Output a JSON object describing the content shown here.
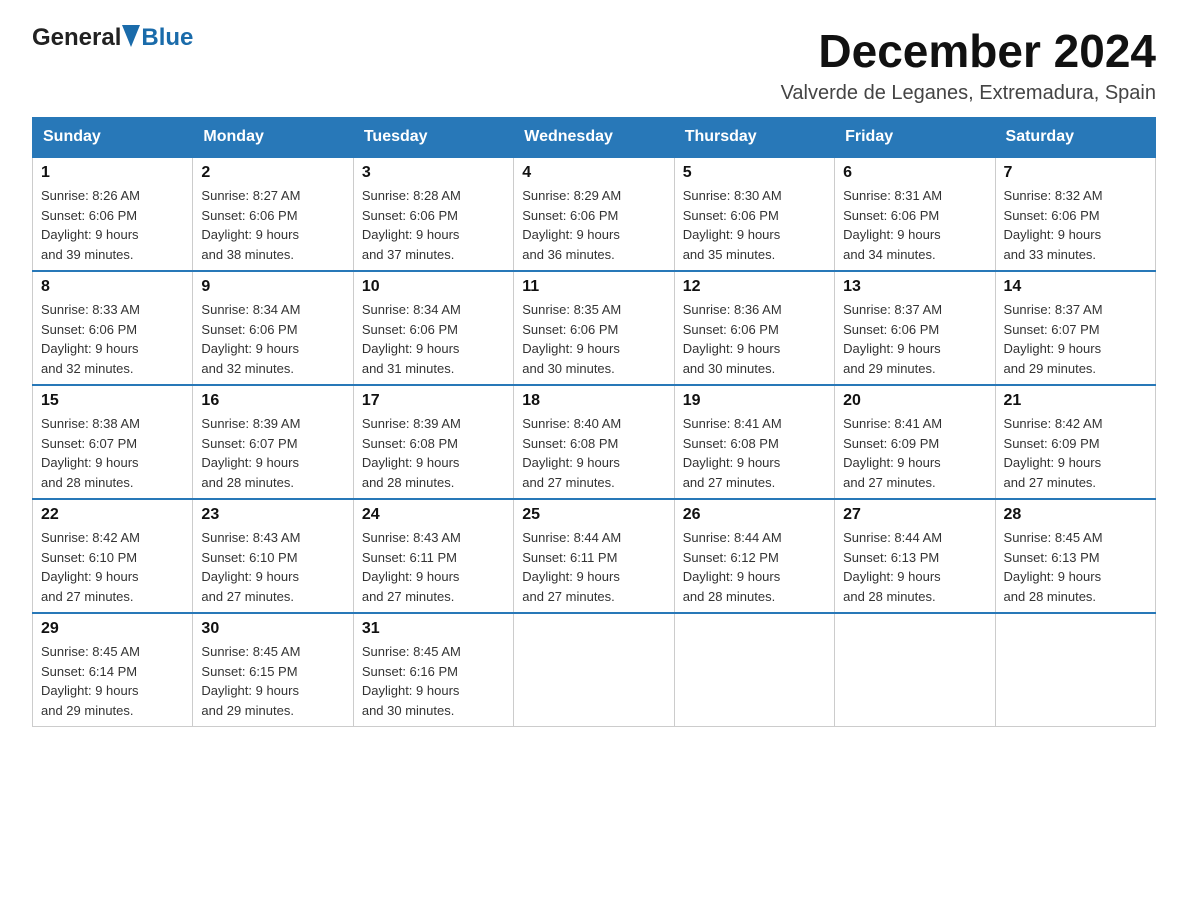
{
  "header": {
    "logo_general": "General",
    "logo_blue": "Blue",
    "main_title": "December 2024",
    "subtitle": "Valverde de Leganes, Extremadura, Spain"
  },
  "weekdays": [
    "Sunday",
    "Monday",
    "Tuesday",
    "Wednesday",
    "Thursday",
    "Friday",
    "Saturday"
  ],
  "weeks": [
    [
      {
        "day": "1",
        "sunrise": "8:26 AM",
        "sunset": "6:06 PM",
        "daylight": "9 hours and 39 minutes."
      },
      {
        "day": "2",
        "sunrise": "8:27 AM",
        "sunset": "6:06 PM",
        "daylight": "9 hours and 38 minutes."
      },
      {
        "day": "3",
        "sunrise": "8:28 AM",
        "sunset": "6:06 PM",
        "daylight": "9 hours and 37 minutes."
      },
      {
        "day": "4",
        "sunrise": "8:29 AM",
        "sunset": "6:06 PM",
        "daylight": "9 hours and 36 minutes."
      },
      {
        "day": "5",
        "sunrise": "8:30 AM",
        "sunset": "6:06 PM",
        "daylight": "9 hours and 35 minutes."
      },
      {
        "day": "6",
        "sunrise": "8:31 AM",
        "sunset": "6:06 PM",
        "daylight": "9 hours and 34 minutes."
      },
      {
        "day": "7",
        "sunrise": "8:32 AM",
        "sunset": "6:06 PM",
        "daylight": "9 hours and 33 minutes."
      }
    ],
    [
      {
        "day": "8",
        "sunrise": "8:33 AM",
        "sunset": "6:06 PM",
        "daylight": "9 hours and 32 minutes."
      },
      {
        "day": "9",
        "sunrise": "8:34 AM",
        "sunset": "6:06 PM",
        "daylight": "9 hours and 32 minutes."
      },
      {
        "day": "10",
        "sunrise": "8:34 AM",
        "sunset": "6:06 PM",
        "daylight": "9 hours and 31 minutes."
      },
      {
        "day": "11",
        "sunrise": "8:35 AM",
        "sunset": "6:06 PM",
        "daylight": "9 hours and 30 minutes."
      },
      {
        "day": "12",
        "sunrise": "8:36 AM",
        "sunset": "6:06 PM",
        "daylight": "9 hours and 30 minutes."
      },
      {
        "day": "13",
        "sunrise": "8:37 AM",
        "sunset": "6:06 PM",
        "daylight": "9 hours and 29 minutes."
      },
      {
        "day": "14",
        "sunrise": "8:37 AM",
        "sunset": "6:07 PM",
        "daylight": "9 hours and 29 minutes."
      }
    ],
    [
      {
        "day": "15",
        "sunrise": "8:38 AM",
        "sunset": "6:07 PM",
        "daylight": "9 hours and 28 minutes."
      },
      {
        "day": "16",
        "sunrise": "8:39 AM",
        "sunset": "6:07 PM",
        "daylight": "9 hours and 28 minutes."
      },
      {
        "day": "17",
        "sunrise": "8:39 AM",
        "sunset": "6:08 PM",
        "daylight": "9 hours and 28 minutes."
      },
      {
        "day": "18",
        "sunrise": "8:40 AM",
        "sunset": "6:08 PM",
        "daylight": "9 hours and 27 minutes."
      },
      {
        "day": "19",
        "sunrise": "8:41 AM",
        "sunset": "6:08 PM",
        "daylight": "9 hours and 27 minutes."
      },
      {
        "day": "20",
        "sunrise": "8:41 AM",
        "sunset": "6:09 PM",
        "daylight": "9 hours and 27 minutes."
      },
      {
        "day": "21",
        "sunrise": "8:42 AM",
        "sunset": "6:09 PM",
        "daylight": "9 hours and 27 minutes."
      }
    ],
    [
      {
        "day": "22",
        "sunrise": "8:42 AM",
        "sunset": "6:10 PM",
        "daylight": "9 hours and 27 minutes."
      },
      {
        "day": "23",
        "sunrise": "8:43 AM",
        "sunset": "6:10 PM",
        "daylight": "9 hours and 27 minutes."
      },
      {
        "day": "24",
        "sunrise": "8:43 AM",
        "sunset": "6:11 PM",
        "daylight": "9 hours and 27 minutes."
      },
      {
        "day": "25",
        "sunrise": "8:44 AM",
        "sunset": "6:11 PM",
        "daylight": "9 hours and 27 minutes."
      },
      {
        "day": "26",
        "sunrise": "8:44 AM",
        "sunset": "6:12 PM",
        "daylight": "9 hours and 28 minutes."
      },
      {
        "day": "27",
        "sunrise": "8:44 AM",
        "sunset": "6:13 PM",
        "daylight": "9 hours and 28 minutes."
      },
      {
        "day": "28",
        "sunrise": "8:45 AM",
        "sunset": "6:13 PM",
        "daylight": "9 hours and 28 minutes."
      }
    ],
    [
      {
        "day": "29",
        "sunrise": "8:45 AM",
        "sunset": "6:14 PM",
        "daylight": "9 hours and 29 minutes."
      },
      {
        "day": "30",
        "sunrise": "8:45 AM",
        "sunset": "6:15 PM",
        "daylight": "9 hours and 29 minutes."
      },
      {
        "day": "31",
        "sunrise": "8:45 AM",
        "sunset": "6:16 PM",
        "daylight": "9 hours and 30 minutes."
      },
      null,
      null,
      null,
      null
    ]
  ],
  "labels": {
    "sunrise": "Sunrise:",
    "sunset": "Sunset:",
    "daylight": "Daylight:"
  }
}
